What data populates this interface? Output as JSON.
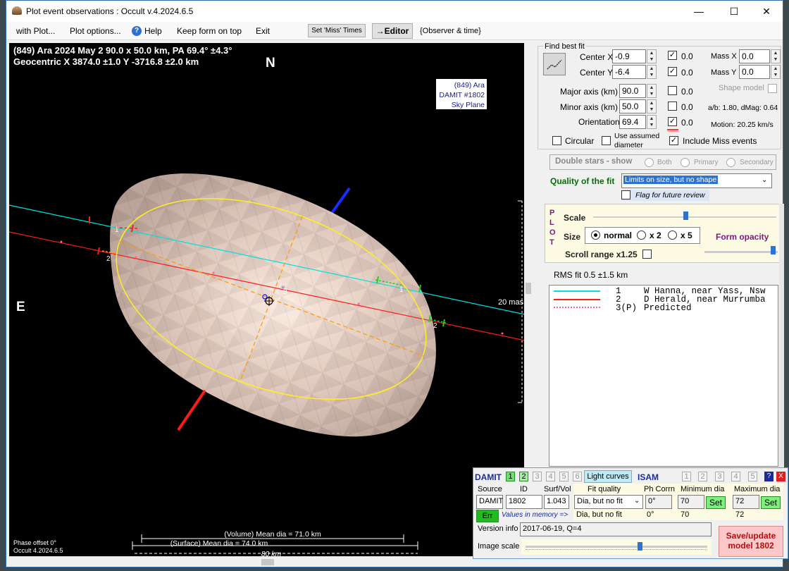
{
  "window": {
    "title": "Plot event observations : Occult v.4.2024.6.5",
    "minimize": "—",
    "maximize": "☐",
    "close": "✕"
  },
  "menu": {
    "with_plot": "with Plot...",
    "plot_options": "Plot options...",
    "help": "Help",
    "keep_on_top": "Keep form on top",
    "exit": "Exit",
    "set_miss_times": "Set 'Miss' Times",
    "editor": "→Editor",
    "observer_time": "{Observer & time}"
  },
  "plot": {
    "header_line1": "(849) Ara  2024 May 2  90.0 x 50.0 km, PA 69.4° ±4.3°",
    "header_line2": "Geocentric  X  3874.0 ±1.0  Y -3716.8 ±2.0 km",
    "north": "N",
    "east": "E",
    "model_label": [
      "(849) Ara",
      "DAMIT #1802",
      "Sky Plane"
    ],
    "scale_mas": "20 mas",
    "volume_dia": "(Volume) Mean dia = 71.0 km",
    "surface_dia": "(Surface) Mean dia = 74.0 km",
    "scale_km": "80 km",
    "phase_offset": "Phase offset 0°",
    "version": "Occult 4.2024.6.5",
    "chord_labels": [
      "1",
      "2",
      "1",
      "2",
      "3"
    ]
  },
  "fit": {
    "section_title": "Find best fit",
    "center_x_label": "Center X",
    "center_x": "-0.9",
    "center_y_label": "Center Y",
    "center_y": "-6.4",
    "major_axis_label": "Major axis (km)",
    "major_axis": "90.0",
    "minor_axis_label": "Minor axis (km)",
    "minor_axis": "50.0",
    "orientation_label": "Orientation",
    "orientation": "69.4",
    "unc_values": [
      "0.0",
      "0.0",
      "0.0",
      "0.0",
      "0.0"
    ],
    "mass_x_label": "Mass X",
    "mass_x": "0.0",
    "mass_y_label": "Mass Y",
    "mass_y": "0.0",
    "shape_model_label": "Shape model",
    "ab_dmag": "a/b: 1.80, dMag: 0.64",
    "motion": "Motion: 20.25 km/s",
    "circular_label": "Circular",
    "use_assumed_label": "Use assumed",
    "diameter_label": "diameter",
    "include_miss_label": "Include Miss events",
    "double_stars": "Double stars - show",
    "both": "Both",
    "primary": "Primary",
    "secondary": "Secondary",
    "quality_label": "Quality of the fit",
    "quality_value": "Limits on size, but no shape",
    "flag_label": "Flag for future review"
  },
  "plot_opts": {
    "plot_letters": [
      "P",
      "L",
      "O",
      "T"
    ],
    "scale_label": "Scale",
    "size_label": "Size",
    "size_normal": "normal",
    "size_x2": "x 2",
    "size_x5": "x 5",
    "form_opacity": "Form opacity",
    "scroll_range": "Scroll range x1.25"
  },
  "rms_fit": "RMS fit 0.5 ±1.5 km",
  "legend": [
    {
      "num": "1",
      "name": "W Hanna, near Yass, Nsw"
    },
    {
      "num": "2",
      "name": "D Herald, near Murrumba"
    },
    {
      "num": "3(P)",
      "name": "Predicted"
    }
  ],
  "damit": {
    "damit_label": "DAMIT",
    "isam_label": "ISAM",
    "tabs": [
      "1",
      "2",
      "3",
      "4",
      "5",
      "6"
    ],
    "light_curves": "Light curves",
    "help": "?",
    "close": "X",
    "source_label": "Source",
    "source": "DAMIT",
    "id_label": "ID",
    "id": "1802",
    "surfvol_label": "Surf/Vol",
    "surfvol": "1.043",
    "err": "Err",
    "values_in_memory": "Values in memory =>",
    "fit_quality_label": "Fit quality",
    "fit_quality": "Dia, but no fit",
    "fit_quality_mem": "Dia, but no fit",
    "ph_corrn_label": "Ph Corrn",
    "ph_corrn": "0°",
    "ph_corrn_mem": "0°",
    "min_dia_label": "Minimum dia",
    "min_dia": "70",
    "min_dia_mem": "70",
    "max_dia_label": "Maximum dia",
    "max_dia": "72",
    "max_dia_mem": "72",
    "set": "Set",
    "version_info_label": "Version info",
    "version_info": "2017-06-19, Q=4",
    "image_scale_label": "Image scale",
    "save_update": "Save/update",
    "model_num": "model  1802"
  },
  "colors": {
    "chord1": "#00e0e0",
    "chord2": "#ff1a1a",
    "ellipse": "#ffee22",
    "shape_model": "#e8d3c8",
    "accent_green": "#6ce36c",
    "save_button": "#ffc8c8"
  }
}
